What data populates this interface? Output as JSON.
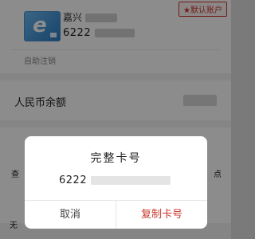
{
  "card": {
    "bank_name": "嘉兴",
    "number_prefix": "6222",
    "default_badge": "★默认账户",
    "self_service": "自助注销"
  },
  "balance": {
    "label": "人民币余额"
  },
  "background_rows": {
    "left_text": "查",
    "right_text": "点",
    "bottom_text": "无"
  },
  "dialog": {
    "title": "完整卡号",
    "number_prefix": "6222",
    "cancel_label": "取消",
    "copy_label": "复制卡号"
  },
  "colors": {
    "accent": "#c8372d",
    "overlay": "rgba(0,0,0,0.45)"
  },
  "icons": {
    "card_logo": "bank-card-icon"
  }
}
